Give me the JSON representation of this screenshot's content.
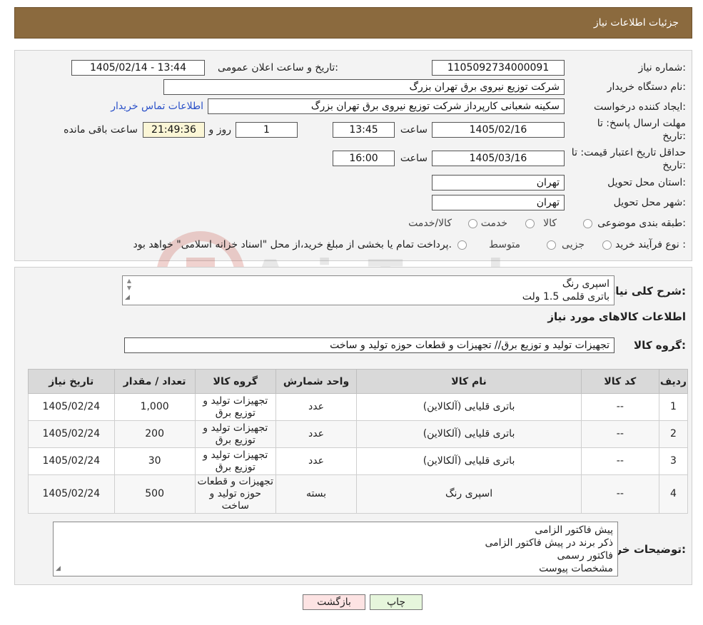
{
  "header": {
    "title": "جزئیات اطلاعات نیاز"
  },
  "watermark": {
    "text": "AriaTender.neT"
  },
  "form": {
    "need_number_label": "شماره نیاز:",
    "need_number": "1105092734000091",
    "announce_label": "تاریخ و ساعت اعلان عمومی:",
    "announce_value": "1405/02/14 - 13:44",
    "buyer_org_label": "نام دستگاه خریدار:",
    "buyer_org": "شرکت توزیع نیروی برق تهران بزرگ",
    "requester_label": "ایجاد کننده درخواست:",
    "requester": "سکینه شعبانی کارپرداز شرکت توزیع نیروی برق تهران بزرگ",
    "contact_link": "اطلاعات تماس خریدار",
    "deadline_label_1": "مهلت ارسال پاسخ: تا",
    "deadline_label_2": "تاریخ:",
    "deadline_date": "1405/02/16",
    "time_label": "ساعت",
    "deadline_time": "13:45",
    "days_value": "1",
    "days_label": "روز و",
    "remaining_time": "21:49:36",
    "remaining_label": "ساعت باقی مانده",
    "validity_label_1": "حداقل تاریخ اعتبار قیمت: تا",
    "validity_label_2": "تاریخ:",
    "validity_date": "1405/03/16",
    "validity_time": "16:00",
    "province_label": "استان محل تحویل:",
    "province": "تهران",
    "city_label": "شهر محل تحویل:",
    "city": "تهران",
    "category_label": "طبقه بندی موضوعی:",
    "category_options": [
      "کالا",
      "خدمت",
      "کالا/خدمت"
    ],
    "process_label": "نوع فرآیند خرید :",
    "process_options": [
      "جزیی",
      "متوسط"
    ],
    "process_note": "پرداخت تمام یا بخشی از مبلغ خرید،از محل \"اسناد خزانه اسلامی\" خواهد بود."
  },
  "details": {
    "summary_label": "شرح کلی نیاز:",
    "summary_lines": [
      "اسپری رنگ",
      "باتری قلمی 1.5 ولت"
    ],
    "goods_info_title": "اطلاعات کالاهای مورد نیاز",
    "goods_group_label": "گروه کالا:",
    "goods_group": "تجهیزات تولید و توزیع برق// تجهیزات و قطعات حوزه تولید و ساخت",
    "table": {
      "headers": [
        "ردیف",
        "کد کالا",
        "نام کالا",
        "واحد شمارش",
        "گروه کالا",
        "تعداد / مقدار",
        "تاریخ نیاز"
      ],
      "rows": [
        [
          "1",
          "--",
          "باتری قلیایی (آلکالاین)",
          "عدد",
          "تجهیزات تولید و توزیع برق",
          "1,000",
          "1405/02/24"
        ],
        [
          "2",
          "--",
          "باتری قلیایی (آلکالاین)",
          "عدد",
          "تجهیزات تولید و توزیع برق",
          "200",
          "1405/02/24"
        ],
        [
          "3",
          "--",
          "باتری قلیایی (آلکالاین)",
          "عدد",
          "تجهیزات تولید و توزیع برق",
          "30",
          "1405/02/24"
        ],
        [
          "4",
          "--",
          "اسپری رنگ",
          "بسته",
          "تجهیزات و قطعات حوزه تولید و ساخت",
          "500",
          "1405/02/24"
        ]
      ]
    },
    "buyer_notes_label": "توضیحات خریدار:",
    "buyer_notes_lines": [
      "پیش فاکتور الزامی",
      "ذکر برند در پیش فاکتور الزامی",
      "فاکتور رسمی",
      "مشخصات پیوست"
    ]
  },
  "buttons": {
    "print": "چاپ",
    "back": "بازگشت"
  },
  "colors": {
    "header_bg": "#8b6a3e",
    "back_button_bg": "#fde3e3",
    "print_button_bg": "#e6f6dc",
    "link": "#2a50c8"
  }
}
